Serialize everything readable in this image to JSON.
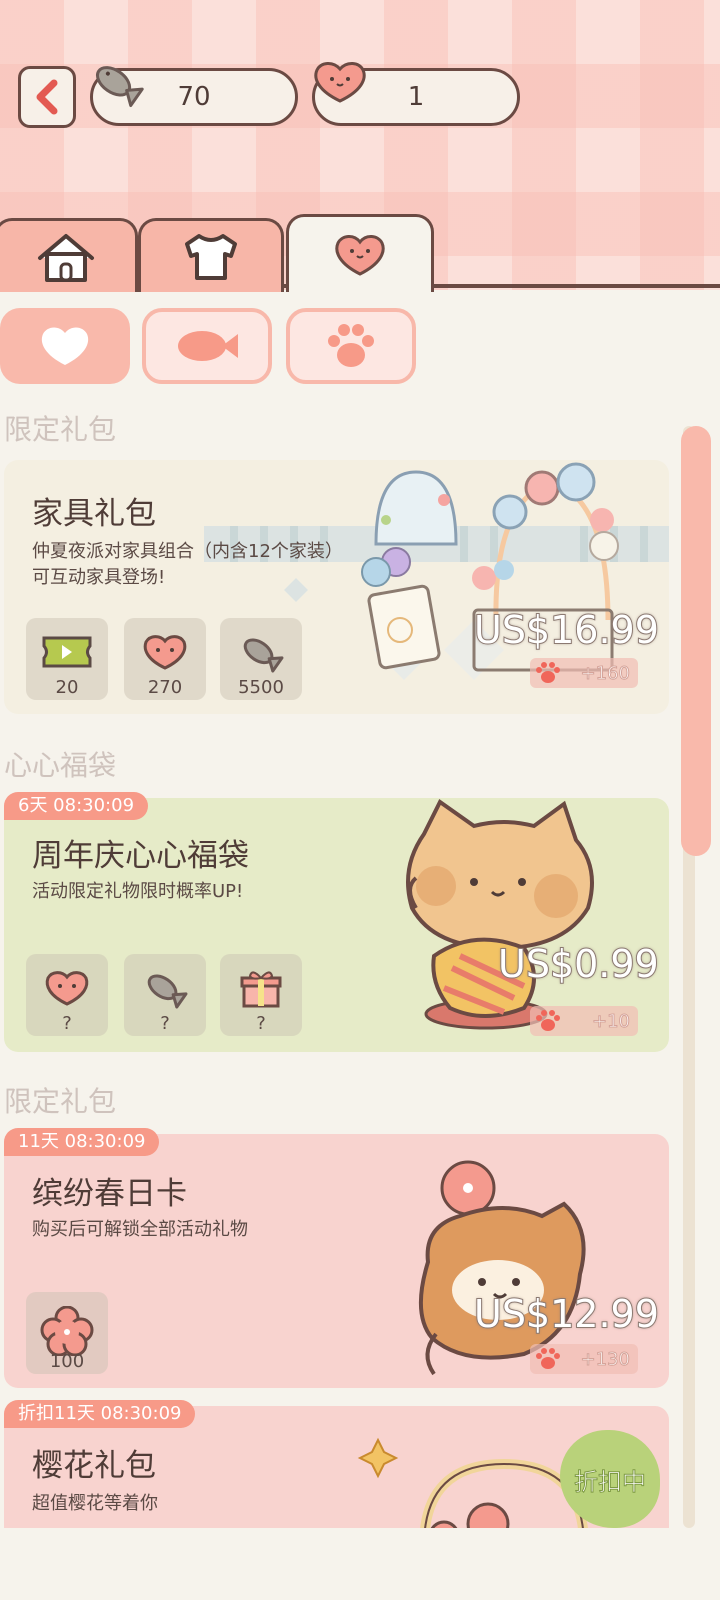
{
  "header": {
    "fish_count": "70",
    "heart_count": "1"
  },
  "tabs": [
    "home-icon",
    "shirt-icon",
    "heart-icon"
  ],
  "filters": [
    "heart-icon",
    "fish-icon",
    "paw-icon"
  ],
  "sections": {
    "s1_label": "限定礼包",
    "s2_label": "心心福袋",
    "s3_label": "限定礼包"
  },
  "cards": [
    {
      "title": "家具礼包",
      "desc_line1": "仲夏夜派对家具组合（内含12个家装）",
      "desc_line2": "可互动家具登场!",
      "items": [
        {
          "icon": "ticket-icon",
          "qty": "20"
        },
        {
          "icon": "heart-icon",
          "qty": "270"
        },
        {
          "icon": "fish-icon",
          "qty": "5500"
        }
      ],
      "price": "US$16.99",
      "bonus": "+160"
    },
    {
      "timer": "6天 08:30:09",
      "title": "周年庆心心福袋",
      "desc_line1": "活动限定礼物限时概率UP!",
      "items": [
        {
          "icon": "heart-icon",
          "qty": "?"
        },
        {
          "icon": "fish-icon",
          "qty": "?"
        },
        {
          "icon": "gift-icon",
          "qty": "?"
        }
      ],
      "price": "US$0.99",
      "bonus": "+10"
    },
    {
      "timer": "11天 08:30:09",
      "title": "缤纷春日卡",
      "desc_line1": "购买后可解锁全部活动礼物",
      "items": [
        {
          "icon": "flower-icon",
          "qty": "100"
        }
      ],
      "price": "US$12.99",
      "bonus": "+130"
    },
    {
      "timer": "折扣11天 08:30:09",
      "title": "樱花礼包",
      "desc_line1": "超值樱花等着你",
      "badge": "折扣中"
    }
  ],
  "colors": {
    "accent_pink": "#f9b9ab",
    "timer_red": "#f79a88",
    "outline_brown": "#6b4a43",
    "card_cream": "#f3efe2",
    "card_green": "#e6ebc8",
    "card_pink": "#f8d3cf"
  }
}
